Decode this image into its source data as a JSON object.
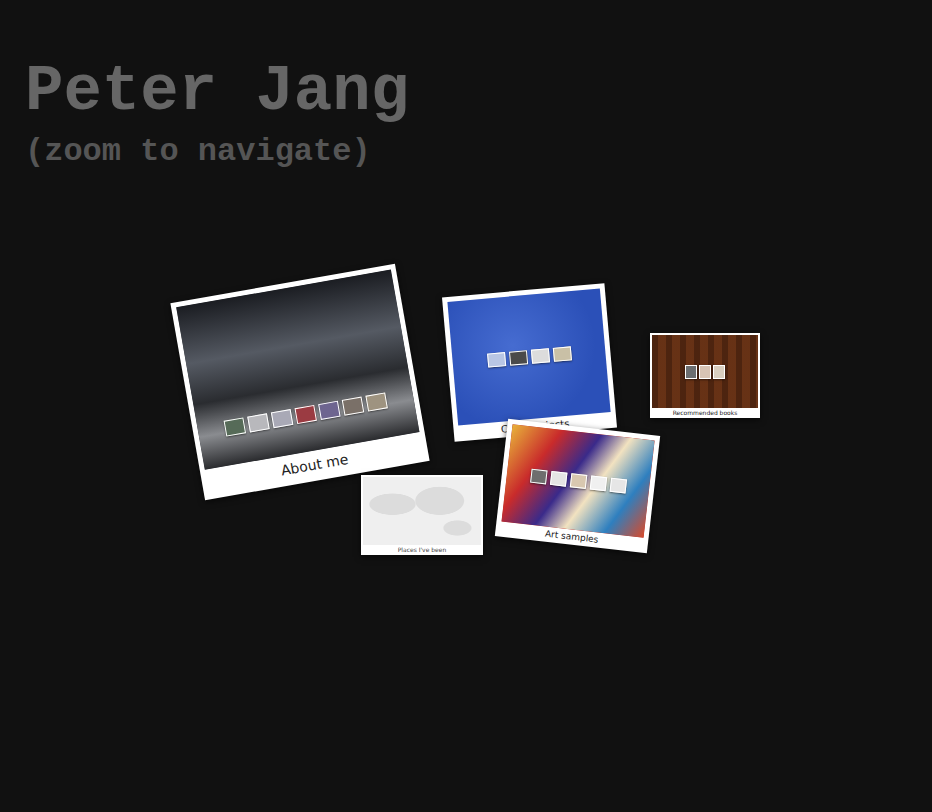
{
  "header": {
    "title": "Peter Jang",
    "subtitle": "(zoom to navigate)"
  },
  "cards": [
    {
      "caption": "About me",
      "color": "#3a3d44",
      "thumbnails": [
        {
          "color": "#566b58"
        },
        {
          "color": "#b8b8bc"
        },
        {
          "color": "#a9a9b6"
        },
        {
          "color": "#9b3b42"
        },
        {
          "color": "#6e6590"
        },
        {
          "color": "#7a7068"
        },
        {
          "color": "#9e9380"
        }
      ]
    },
    {
      "caption": "Code projects",
      "color": "#2b50b8",
      "thumbnails": [
        {
          "color": "#b8c6e4"
        },
        {
          "color": "#4a4a4a"
        },
        {
          "color": "#dcdcdc"
        },
        {
          "color": "#c9c0a6"
        }
      ]
    },
    {
      "caption": "Recommended books",
      "color": "#5a2a12",
      "thumbnails": [
        {
          "color": "#6b6e70"
        },
        {
          "color": "#d8c4b4"
        },
        {
          "color": "#d9cfc0"
        }
      ]
    },
    {
      "caption": "Art samples",
      "color": "#b8332a",
      "thumbnails": [
        {
          "color": "#6e6e6e"
        },
        {
          "color": "#e4e4e4"
        },
        {
          "color": "#d8c8b0"
        },
        {
          "color": "#f0f0f0"
        },
        {
          "color": "#e6e6e6"
        }
      ]
    },
    {
      "caption": "Places I've been",
      "color": "#efefef",
      "thumbnails": []
    }
  ]
}
